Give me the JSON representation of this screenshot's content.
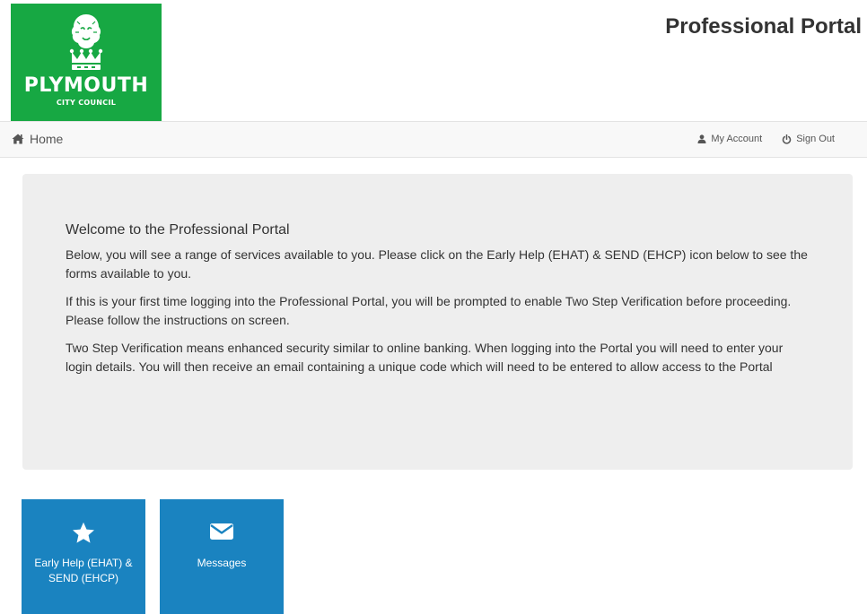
{
  "header": {
    "logo": {
      "name": "PLYMOUTH",
      "subtitle": "CITY COUNCIL"
    },
    "title": "Professional Portal"
  },
  "nav": {
    "home_label": "Home",
    "my_account_label": "My Account",
    "sign_out_label": "Sign Out"
  },
  "welcome": {
    "heading": "Welcome to the Professional Portal",
    "paragraphs": [
      "Below, you will see a range of services available to you. Please click on the Early Help (EHAT) & SEND (EHCP) icon below to see the forms available to you.",
      "If this is your first time logging into the Professional Portal, you will be prompted to enable Two Step Verification before proceeding. Please follow the instructions on screen.",
      "Two Step Verification means enhanced security similar to online banking. When logging into the Portal you will need to enter your login details. You will then receive an email containing a unique code which will need to be entered to allow access to the Portal"
    ]
  },
  "tiles": [
    {
      "label": "Early Help (EHAT) & SEND (EHCP)",
      "icon": "star-icon"
    },
    {
      "label": "Messages",
      "icon": "envelope-icon"
    }
  ],
  "colors": {
    "brand_green": "#17a843",
    "tile_blue": "#1a83c0",
    "panel_gray": "#eeeeee",
    "navbar_bg": "#f8f8f8"
  }
}
